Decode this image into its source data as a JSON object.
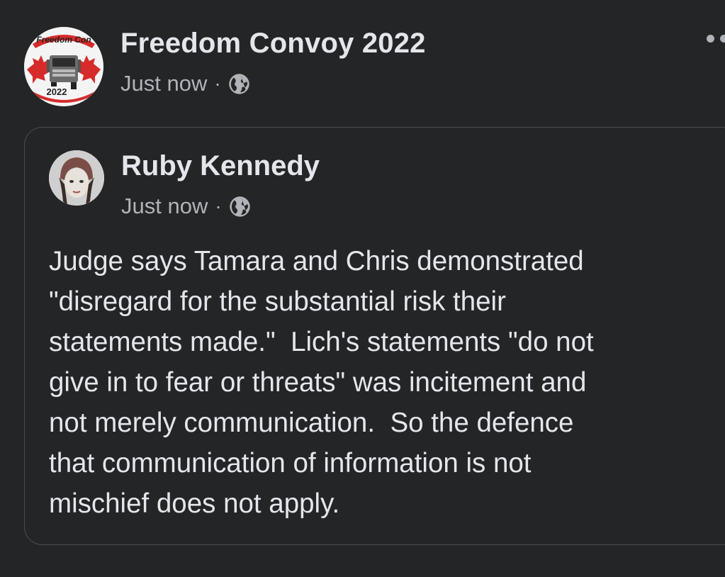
{
  "post": {
    "page_name": "Freedom Convoy 2022",
    "timestamp": "Just now",
    "separator": "·",
    "privacy_icon": "globe-icon",
    "avatar_text_top": "Freedom Con",
    "avatar_text_year": "2022"
  },
  "shared_post": {
    "author": "Ruby Kennedy",
    "timestamp": "Just now",
    "separator": "·",
    "privacy_icon": "globe-icon",
    "body": "Judge says Tamara and Chris demonstrated\n\"disregard for the substantial risk their\nstatements made.\"  Lich's statements \"do not\ngive in to fear or threats\" was incitement and\nnot merely communication.  So the defence\nthat communication of information is not\nmischief does not apply."
  },
  "colors": {
    "background": "#242526",
    "primary_text": "#e4e6eb",
    "secondary_text": "#b0b3b8",
    "card_border": "#4b4c4f",
    "maple_red": "#d62b2b"
  }
}
